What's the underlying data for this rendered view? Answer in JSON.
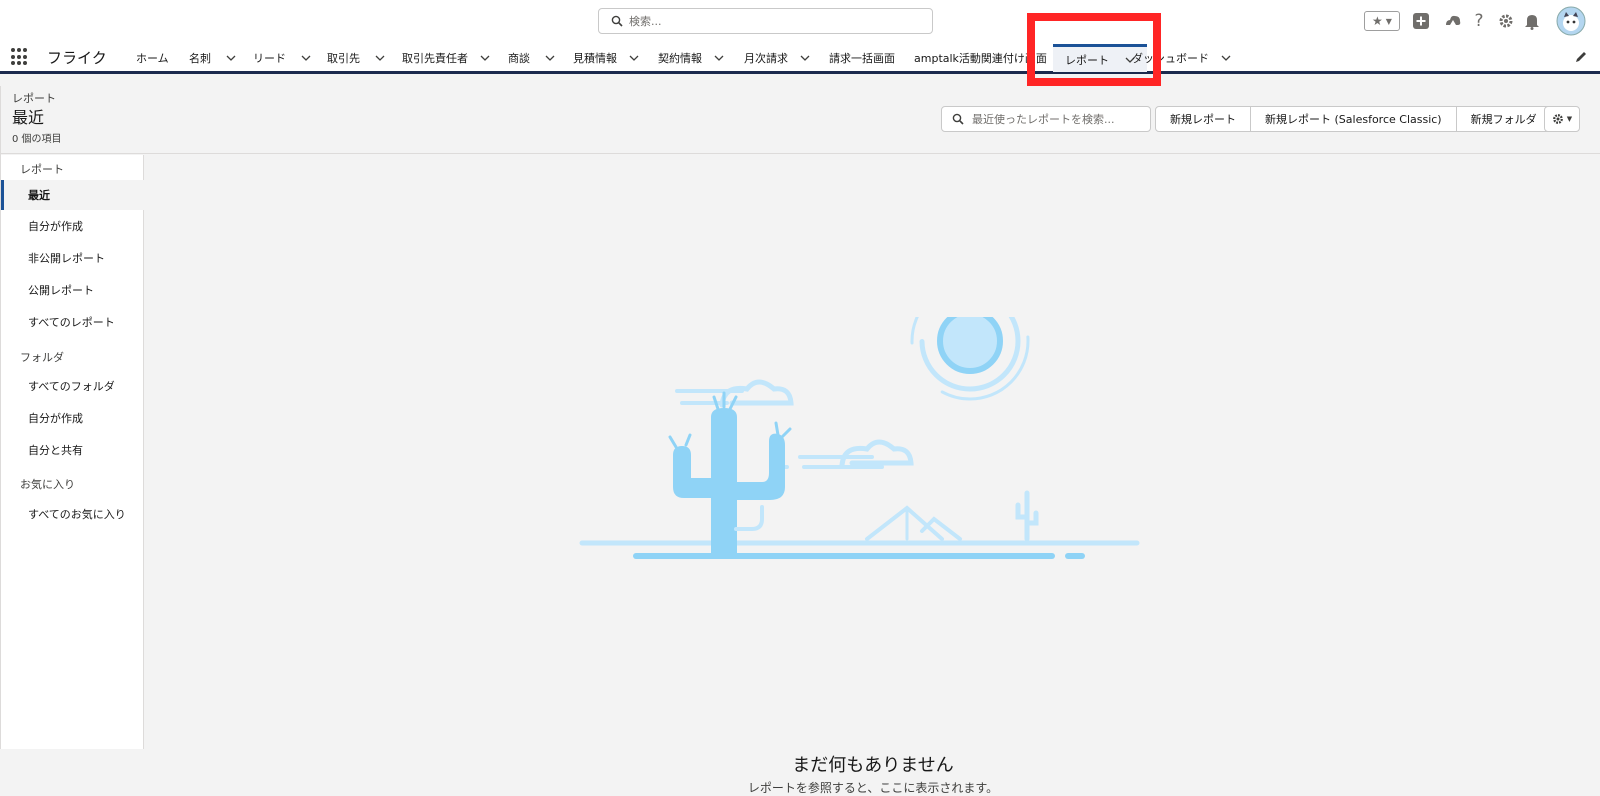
{
  "global_search": {
    "placeholder": "検索..."
  },
  "app": {
    "name": "フライク"
  },
  "nav": {
    "items": [
      {
        "label": "ホーム"
      },
      {
        "label": "名刺"
      },
      {
        "label": "リード"
      },
      {
        "label": "取引先"
      },
      {
        "label": "取引先責任者"
      },
      {
        "label": "商談"
      },
      {
        "label": "見積情報"
      },
      {
        "label": "契約情報"
      },
      {
        "label": "月次請求"
      },
      {
        "label": "請求一括画面"
      },
      {
        "label": "amptalk活動関連付け画面"
      },
      {
        "label": "レポート"
      },
      {
        "label": "ダッシュボード"
      }
    ]
  },
  "header": {
    "object_label": "レポート",
    "title": "最近",
    "count": "0 個の項目",
    "search_placeholder": "最近使ったレポートを検索...",
    "buttons": [
      "新規レポート",
      "新規レポート (Salesforce Classic)",
      "新規フォルダ"
    ]
  },
  "sidebar": {
    "section_reports": "レポート",
    "reports": [
      "最近",
      "自分が作成",
      "非公開レポート",
      "公開レポート",
      "すべてのレポート"
    ],
    "section_folders": "フォルダ",
    "folders": [
      "すべてのフォルダ",
      "自分が作成",
      "自分と共有"
    ],
    "section_favorites": "お気に入り",
    "favorites": [
      "すべてのお気に入り"
    ]
  },
  "empty_state": {
    "title": "まだ何もありません",
    "subtitle": "レポートを参照すると、ここに表示されます。"
  },
  "colors": {
    "accent": "#1b5297",
    "highlight": "#ff2525",
    "illustration": "#8fd3f6"
  }
}
